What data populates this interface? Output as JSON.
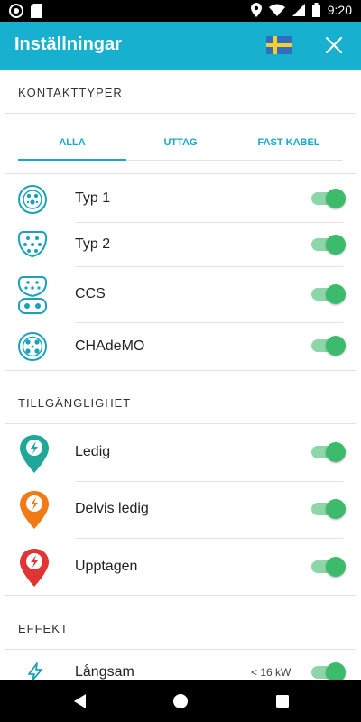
{
  "status_bar": {
    "time": "9:20"
  },
  "header": {
    "title": "Inställningar",
    "flag_icon": "sweden-flag-icon",
    "close_icon": "close-icon"
  },
  "connectors": {
    "heading": "KONTAKTTYPER",
    "tabs": [
      {
        "label": "ALLA",
        "selected": true
      },
      {
        "label": "UTTAG",
        "selected": false
      },
      {
        "label": "FAST KABEL",
        "selected": false
      }
    ],
    "items": [
      {
        "label": "Typ 1",
        "icon": "type1-connector-icon",
        "enabled": true
      },
      {
        "label": "Typ 2",
        "icon": "type2-connector-icon",
        "enabled": true
      },
      {
        "label": "CCS",
        "icon": "ccs-connector-icon",
        "enabled": true
      },
      {
        "label": "CHAdeMO",
        "icon": "chademo-connector-icon",
        "enabled": true
      }
    ]
  },
  "availability": {
    "heading": "TILLGÄNGLIGHET",
    "items": [
      {
        "label": "Ledig",
        "icon": "marker-available-icon",
        "color": "#1fa89a",
        "enabled": true
      },
      {
        "label": "Delvis ledig",
        "icon": "marker-partial-icon",
        "color": "#ef7a16",
        "enabled": true
      },
      {
        "label": "Upptagen",
        "icon": "marker-occupied-icon",
        "color": "#e23434",
        "enabled": true
      }
    ]
  },
  "power": {
    "heading": "EFFEKT",
    "items": [
      {
        "label": "Långsam",
        "sub": "< 16 kW",
        "icon": "lightning-icon",
        "enabled": true
      }
    ]
  },
  "colors": {
    "primary": "#17b1cf",
    "toggle_on": "#3dbb6c",
    "toggle_track": "#8dd6a8"
  }
}
